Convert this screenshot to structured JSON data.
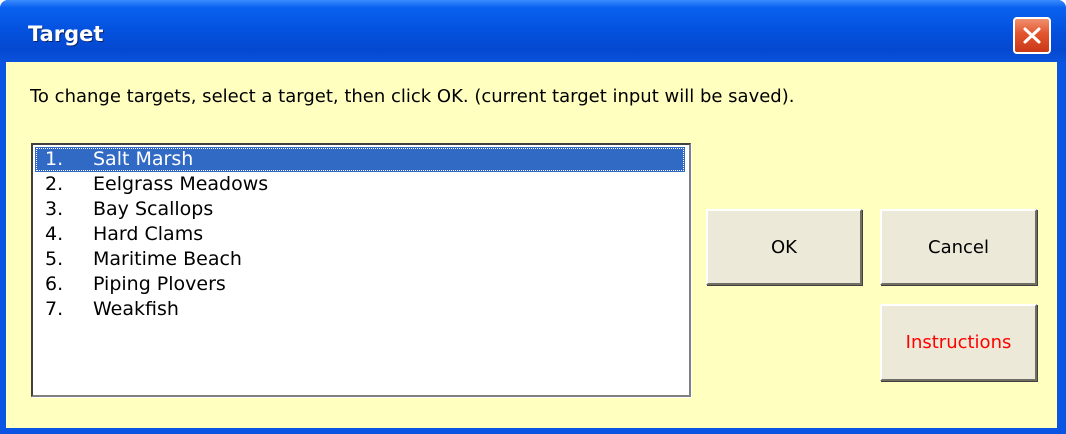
{
  "window": {
    "title": "Target",
    "close_icon": "close-icon"
  },
  "dialog": {
    "instruction": "To change targets, select a target, then click OK. (current target input will be saved)."
  },
  "targets": {
    "selected_index": 0,
    "items": [
      {
        "num": "1.",
        "label": "Salt Marsh"
      },
      {
        "num": "2.",
        "label": "Eelgrass Meadows"
      },
      {
        "num": "3.",
        "label": "Bay Scallops"
      },
      {
        "num": "4.",
        "label": "Hard Clams"
      },
      {
        "num": "5.",
        "label": "Maritime Beach"
      },
      {
        "num": "6.",
        "label": "Piping Plovers"
      },
      {
        "num": "7.",
        "label": "Weakfish"
      }
    ]
  },
  "buttons": {
    "ok_label": "OK",
    "cancel_label": "Cancel",
    "instructions_label": "Instructions"
  },
  "colors": {
    "title_bar": "#0453e0",
    "client_bg": "#ffffc0",
    "selection": "#316ac5",
    "instructions_text": "#ff0000",
    "button_face": "#ece9d8"
  }
}
